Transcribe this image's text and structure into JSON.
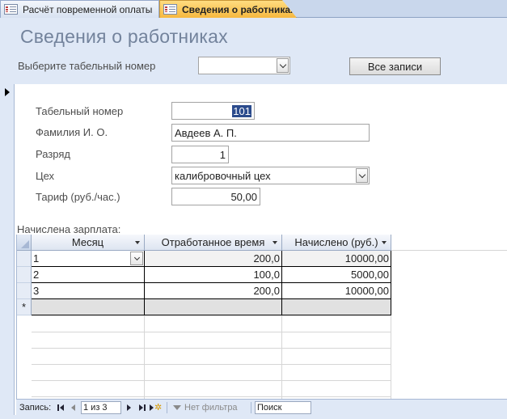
{
  "tabs": [
    {
      "label": "Расчёт повременной оплаты",
      "active": false
    },
    {
      "label": "Сведения о работниках",
      "active": true
    }
  ],
  "header": {
    "title": "Сведения о работниках",
    "select_label": "Выберите табельный номер",
    "select_value": "",
    "all_records_label": "Все записи"
  },
  "fields": {
    "tab_number": {
      "label": "Табельный номер",
      "value": "101"
    },
    "name": {
      "label": "Фамилия И. О.",
      "value": "Авдеев А. П."
    },
    "grade": {
      "label": "Разряд",
      "value": "1"
    },
    "workshop": {
      "label": "Цех",
      "value": "калибровочный цех"
    },
    "rate": {
      "label": "Тариф (руб./час.)",
      "value": "50,00"
    }
  },
  "subform": {
    "caption": "Начислена зарплата:",
    "columns": [
      "Месяц",
      "Отработанное время",
      "Начислено (руб.)"
    ],
    "rows": [
      {
        "month": "1",
        "hours": "200,0",
        "amount": "10000,00"
      },
      {
        "month": "2",
        "hours": "100,0",
        "amount": "5000,00"
      },
      {
        "month": "3",
        "hours": "200,0",
        "amount": "10000,00"
      }
    ],
    "new_row_marker": "*"
  },
  "navigation": {
    "label": "Запись:",
    "position": "1 из 3",
    "filter": "Нет фильтра",
    "search": "Поиск"
  },
  "colors": {
    "header_bg": "#dfe8f6",
    "active_tab": "#f6b83f",
    "title_color": "#73839c"
  }
}
